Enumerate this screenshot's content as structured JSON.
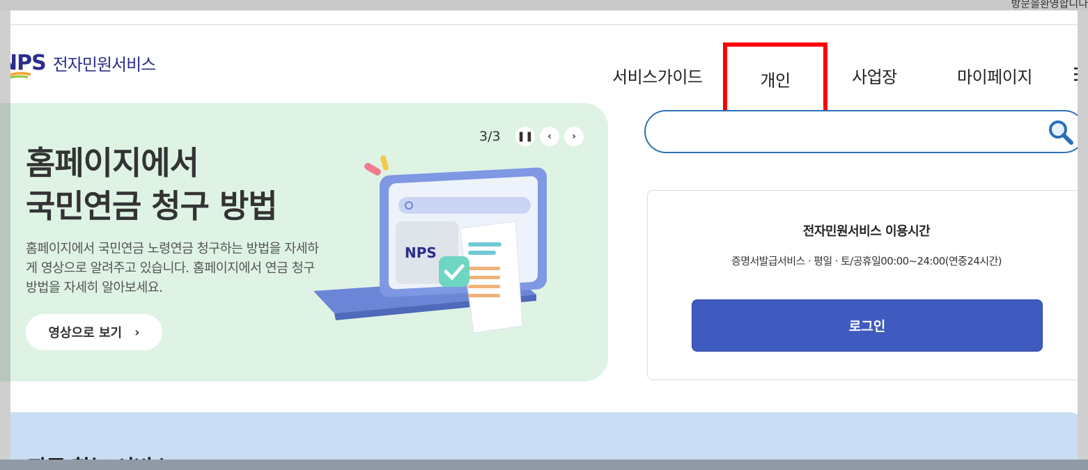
{
  "top_bar": {
    "greeting": "방문을환영합니다"
  },
  "header": {
    "logo_mark": "NPS",
    "logo_text": "전자민원서비스",
    "nav": {
      "guide": "서비스가이드",
      "personal": "개인",
      "business": "사업장",
      "mypage": "마이페이지"
    },
    "menu_icon": "hamburger-icon"
  },
  "hero": {
    "title_line1": "홈페이지에서",
    "title_line2": "국민연금 청구 방법",
    "description": "홈페이지에서 국민연금 노령연금 청구하는 방법을 자세하게 영상으로 알려주고 있습니다. 홈페이지에서 연금 청구방법을 자세히 알아보세요.",
    "button_label": "영상으로 보기",
    "counter": "3/3",
    "illustration_logo": "NPS",
    "colors": {
      "background": "#dff3e5",
      "accent": "#3f5bbf"
    }
  },
  "search": {
    "placeholder": "",
    "value": ""
  },
  "service_card": {
    "title": "전자민원서비스 이용시간",
    "hours": "증명서발급서비스 · 평일 · 토/공휴일00:00~24:00(연중24시간)",
    "login_label": "로그인"
  },
  "frequent": {
    "title": "자주 찾는 서비스"
  },
  "colors": {
    "brand": "#2b2d8c",
    "highlight": "#ff0000",
    "login": "#3f5bbf",
    "search_border": "#2a6fb8"
  }
}
